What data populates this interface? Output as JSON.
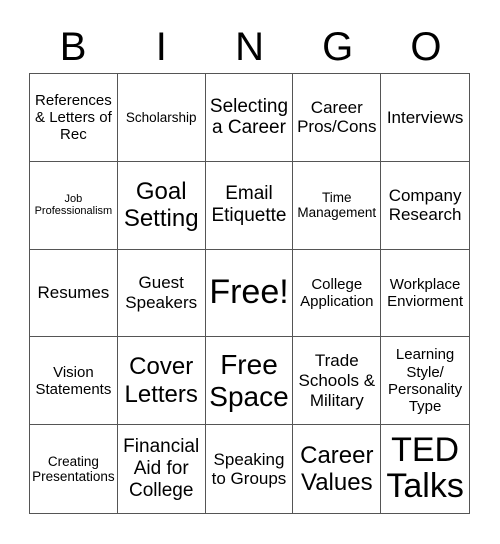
{
  "header": [
    "B",
    "I",
    "N",
    "G",
    "O"
  ],
  "cells": [
    {
      "text": "References & Letters of Rec",
      "size": "s3"
    },
    {
      "text": "Scholarship",
      "size": "s2"
    },
    {
      "text": "Selecting a Career",
      "size": "s5"
    },
    {
      "text": "Career Pros/Cons",
      "size": "s4"
    },
    {
      "text": "Interviews",
      "size": "s4"
    },
    {
      "text": "Job Professionalism",
      "size": "s1"
    },
    {
      "text": "Goal Setting",
      "size": "s6"
    },
    {
      "text": "Email Etiquette",
      "size": "s5"
    },
    {
      "text": "Time Management",
      "size": "s2"
    },
    {
      "text": "Company Research",
      "size": "s4"
    },
    {
      "text": "Resumes",
      "size": "s4"
    },
    {
      "text": "Guest Speakers",
      "size": "s4"
    },
    {
      "text": "Free!",
      "size": "sfree"
    },
    {
      "text": "College Application",
      "size": "s3"
    },
    {
      "text": "Workplace Enviorment",
      "size": "s3"
    },
    {
      "text": "Vision Statements",
      "size": "s3"
    },
    {
      "text": "Cover Letters",
      "size": "s6"
    },
    {
      "text": "Free Space",
      "size": "s7"
    },
    {
      "text": "Trade Schools & Military",
      "size": "s4"
    },
    {
      "text": "Learning Style/ Personality Type",
      "size": "s3"
    },
    {
      "text": "Creating Presentations",
      "size": "s2"
    },
    {
      "text": "Financial Aid for College",
      "size": "s5"
    },
    {
      "text": "Speaking to Groups",
      "size": "s4"
    },
    {
      "text": "Career Values",
      "size": "s6"
    },
    {
      "text": "TED Talks",
      "size": "s8"
    }
  ]
}
